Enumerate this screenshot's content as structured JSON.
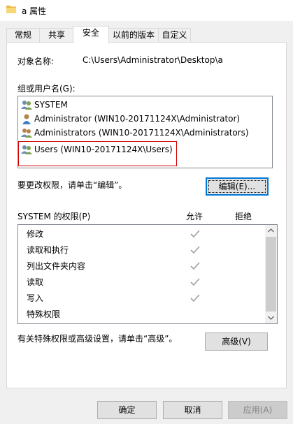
{
  "window": {
    "title": "a 属性"
  },
  "tabs": [
    {
      "label": "常规"
    },
    {
      "label": "共享"
    },
    {
      "label": "安全"
    },
    {
      "label": "以前的版本"
    },
    {
      "label": "自定义"
    }
  ],
  "security": {
    "object_name_label": "对象名称:",
    "object_name_value": "C:\\Users\\Administrator\\Desktop\\a",
    "group_label": "组或用户名(G):",
    "users": [
      {
        "name": "SYSTEM",
        "icon": "user-group-icon"
      },
      {
        "name": "Administrator (WIN10-20171124X\\Administrator)",
        "icon": "user-icon"
      },
      {
        "name": "Administrators (WIN10-20171124X\\Administrators)",
        "icon": "user-group-icon"
      },
      {
        "name": "Users (WIN10-20171124X\\Users)",
        "icon": "user-group-icon"
      }
    ],
    "change_hint": "要更改权限，请单击“编辑”。",
    "edit_button": "编辑(E)...",
    "perm_header": "SYSTEM 的权限(P)",
    "allow_header": "允许",
    "deny_header": "拒绝",
    "permissions": [
      {
        "name": "修改",
        "allow": true,
        "deny": false
      },
      {
        "name": "读取和执行",
        "allow": true,
        "deny": false
      },
      {
        "name": "列出文件夹内容",
        "allow": true,
        "deny": false
      },
      {
        "name": "读取",
        "allow": true,
        "deny": false
      },
      {
        "name": "写入",
        "allow": true,
        "deny": false
      },
      {
        "name": "特殊权限",
        "allow": false,
        "deny": false
      }
    ],
    "advanced_hint": "有关特殊权限或高级设置，请单击“高级”。",
    "advanced_button": "高级(V)"
  },
  "footer": {
    "ok_button": "确定",
    "cancel_button": "取消",
    "apply_button": "应用(A)"
  },
  "colors": {
    "accent": "#0078d7",
    "highlight_red": "#d00000",
    "check_gray": "#a0a0a0"
  }
}
